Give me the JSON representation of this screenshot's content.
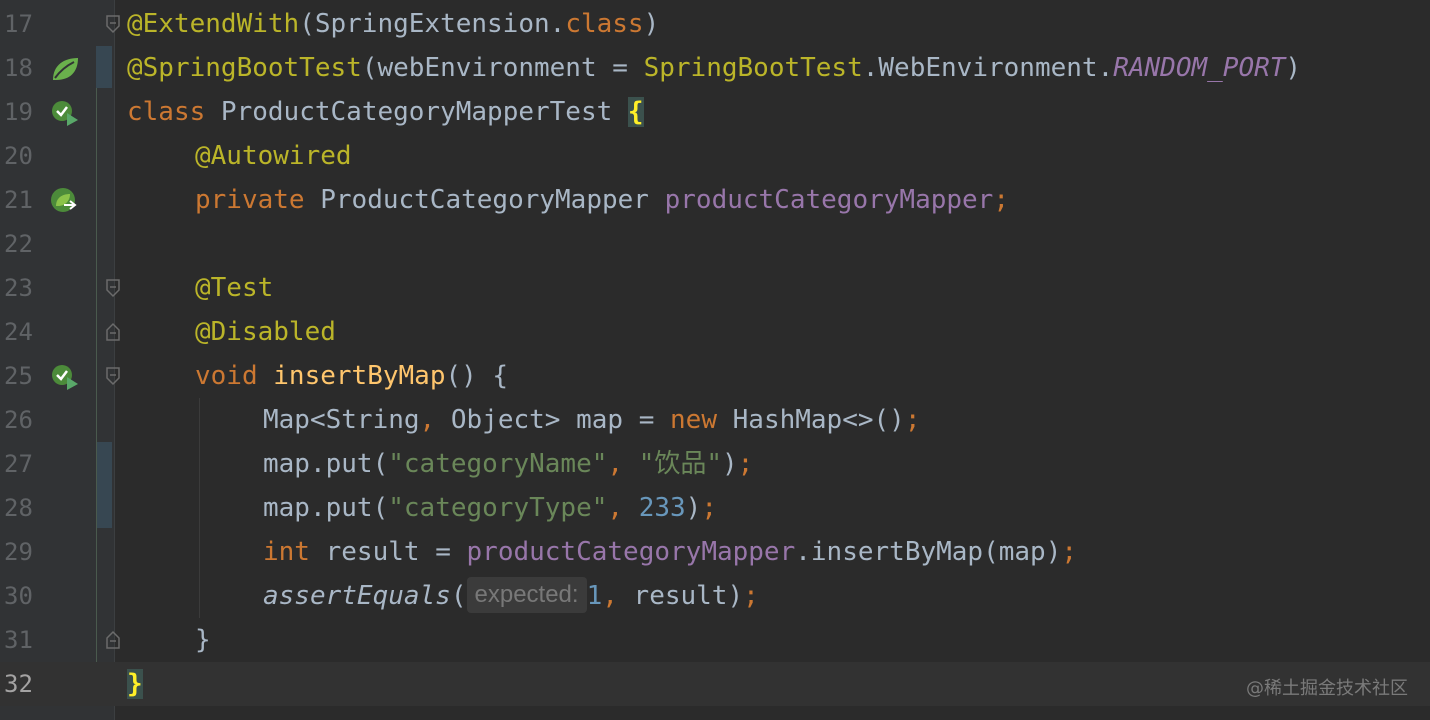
{
  "gutter": {
    "line_numbers": [
      "17",
      "18",
      "19",
      "20",
      "21",
      "22",
      "23",
      "24",
      "25",
      "26",
      "27",
      "28",
      "29",
      "30",
      "31",
      "32"
    ],
    "current_line": "32",
    "icons": {
      "spring_bean": "leaf-icon",
      "run_test": "run-test-icon",
      "navigate_bean": "navigate-bean-icon"
    }
  },
  "code": {
    "l17": {
      "annotation": "@ExtendWith",
      "open": "(",
      "class_ref": "SpringExtension",
      "dot": ".",
      "kw": "class",
      "close": ")"
    },
    "l18": {
      "annotation": "@SpringBootTest",
      "open": "(",
      "param": "webEnvironment",
      "eq": " = ",
      "class_ref": "SpringBootTest",
      "dot1": ".",
      "inner": "WebEnvironment",
      "dot2": ".",
      "constant": "RANDOM_PORT",
      "close": ")"
    },
    "l19": {
      "kw": "class",
      "name": " ProductCategoryMapperTest ",
      "brace": "{"
    },
    "l20": {
      "annotation": "@Autowired"
    },
    "l21": {
      "kw": "private",
      "type": " ProductCategoryMapper ",
      "field": "productCategoryMapper",
      "semi": ";"
    },
    "l23": {
      "annotation": "@Test"
    },
    "l24": {
      "annotation": "@Disabled"
    },
    "l25": {
      "kw": "void",
      "sp": " ",
      "method": "insertByMap",
      "rest": "() {"
    },
    "l26": {
      "type": "Map<String",
      "comma": ",",
      "type2": " Object> map = ",
      "kw": "new",
      "rest": " HashMap<>()",
      "semi": ";"
    },
    "l27": {
      "call": "map.put(",
      "str1": "\"categoryName\"",
      "comma": ", ",
      "str2": "\"饮品\"",
      "close": ")",
      "semi": ";"
    },
    "l28": {
      "call": "map.put(",
      "str1": "\"categoryType\"",
      "comma": ", ",
      "num": "233",
      "close": ")",
      "semi": ";"
    },
    "l29": {
      "kw": "int",
      "mid": " result = ",
      "field": "productCategoryMapper",
      "rest": ".insertByMap(map)",
      "semi": ";"
    },
    "l30": {
      "method": "assertEquals",
      "open": "(",
      "hint": "expected:",
      "num": "1",
      "comma": ",",
      "rest": " result)",
      "semi": ";"
    },
    "l31": {
      "brace": "}"
    },
    "l32": {
      "brace": "}"
    }
  },
  "watermark": "@稀土掘金技术社区",
  "colors": {
    "background": "#2b2b2b",
    "gutter": "#313335",
    "keyword": "#cc7832",
    "annotation": "#bbb529",
    "string": "#6a8759",
    "number": "#6897bb",
    "field": "#9876aa",
    "method_decl": "#ffc66d",
    "default_text": "#a9b7c6",
    "spring_green": "#6ab04c"
  }
}
